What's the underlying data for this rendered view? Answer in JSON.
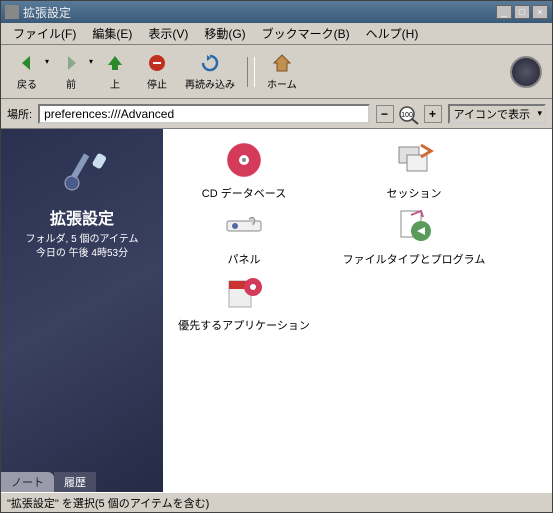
{
  "window": {
    "title": "拡張設定"
  },
  "menu": {
    "file": "ファイル(F)",
    "edit": "編集(E)",
    "view": "表示(V)",
    "go": "移動(G)",
    "bookmarks": "ブックマーク(B)",
    "help": "ヘルプ(H)"
  },
  "toolbar": {
    "back": "戻る",
    "forward": "前",
    "up": "上",
    "stop": "停止",
    "reload": "再読み込み",
    "home": "ホーム"
  },
  "location": {
    "label": "場所:",
    "value": "preferences:///Advanced",
    "zoom_value": "100",
    "view_mode": "アイコンで表示"
  },
  "sidebar": {
    "title": "拡張設定",
    "meta1": "フォルダ, 5 個のアイテム",
    "meta2": "今日の 午後 4時53分",
    "tab_notes": "ノート",
    "tab_history": "履歴"
  },
  "items": [
    {
      "label": "CD データベース"
    },
    {
      "label": "セッション"
    },
    {
      "label": "パネル"
    },
    {
      "label": "ファイルタイプとプログラム"
    },
    {
      "label": "優先するアプリケーション"
    }
  ],
  "status": "\"拡張設定\" を選択(5 個のアイテムを含む)"
}
